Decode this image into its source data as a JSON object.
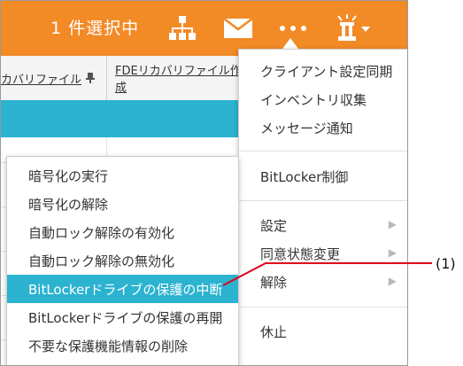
{
  "header": {
    "selection_count": "1 件選択中",
    "icons": [
      "sitemap-icon",
      "mail-icon",
      "more-icon",
      "alert-siren-icon"
    ]
  },
  "tabs": [
    {
      "label": "カバリファイル",
      "icon": "pin-icon"
    },
    {
      "label": "FDEリカバリファイル作成"
    }
  ],
  "menu": {
    "items": [
      {
        "label": "クライアント設定同期"
      },
      {
        "label": "インベントリ収集"
      },
      {
        "label": "メッセージ通知"
      },
      {
        "label": "BitLocker制御"
      },
      {
        "label": "設定",
        "has_submenu": true
      },
      {
        "label": "同意状態変更",
        "has_submenu": true
      },
      {
        "label": "解除",
        "has_submenu": true
      },
      {
        "label": "休止"
      }
    ]
  },
  "submenu": {
    "items": [
      {
        "label": "暗号化の実行"
      },
      {
        "label": "暗号化の解除"
      },
      {
        "label": "自動ロック解除の有効化"
      },
      {
        "label": "自動ロック解除の無効化"
      },
      {
        "label": "BitLockerドライブの保護の中断",
        "highlighted": true
      },
      {
        "label": "BitLockerドライブの保護の再開"
      },
      {
        "label": "不要な保護機能情報の削除"
      }
    ]
  },
  "callout": {
    "label": "(1)"
  },
  "colors": {
    "topbar": "#f28a26",
    "highlight": "#2bb3d0",
    "callout_line": "#e0001a"
  }
}
